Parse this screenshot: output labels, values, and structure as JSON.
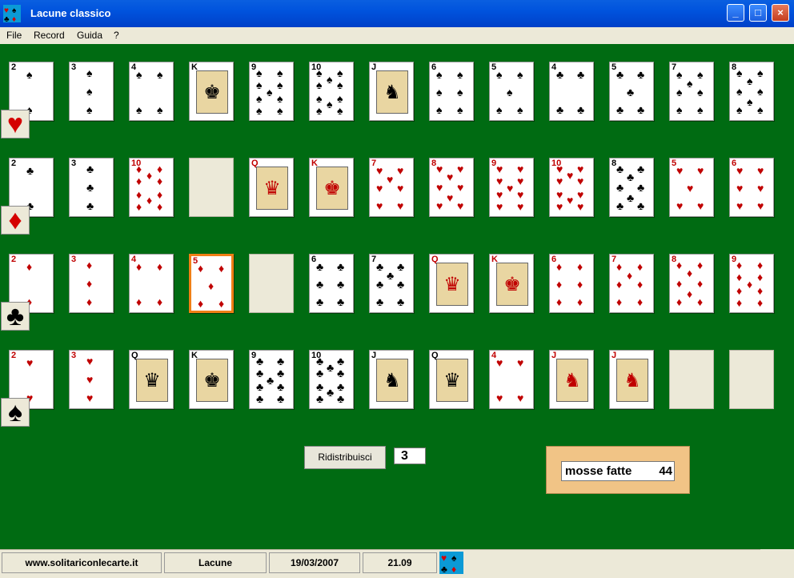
{
  "app": {
    "title": "Lacune  classico",
    "menu": [
      "File",
      "Record",
      "Guida",
      "?"
    ],
    "controls": {
      "minimize": "minimize-icon",
      "maximize": "maximize-icon",
      "close": "close-icon"
    }
  },
  "board": {
    "row_suits": [
      {
        "name": "heart",
        "symbol": "♥",
        "color": "#d40000"
      },
      {
        "name": "diamond",
        "symbol": "♦",
        "color": "#d40000"
      },
      {
        "name": "club",
        "symbol": "♣",
        "color": "#000000"
      },
      {
        "name": "spade",
        "symbol": "♠",
        "color": "#000000"
      }
    ],
    "rows": [
      [
        "2♠",
        "3♠",
        "4♠",
        "K♣",
        "9♠",
        "10♠",
        "J♠",
        "6♠",
        "5♠",
        "4♣",
        "5♣",
        "7♠",
        "8♠"
      ],
      [
        "2♣",
        "3♣",
        "10♦",
        "",
        "Q♦",
        "K♦",
        "7♥",
        "8♥",
        "9♥",
        "10♥",
        "8♣",
        "5♥",
        "6♥"
      ],
      [
        "2♦",
        "3♦",
        "4♦",
        "5♦",
        "",
        "6♣",
        "7♣",
        "Q♥",
        "K♥",
        "6♦",
        "7♦",
        "8♦",
        "9♦"
      ],
      [
        "2♥",
        "3♥",
        "Q♠",
        "K♠",
        "9♣",
        "10♣",
        "J♣",
        "Q♣",
        "4♥",
        "J♥",
        "J♦",
        "",
        ""
      ]
    ],
    "selected_card": "5♦"
  },
  "controls": {
    "redeal_button": "Ridistribuisci",
    "redeal_count": "3"
  },
  "score": {
    "label": "mosse fatte",
    "value": "44"
  },
  "statusbar": {
    "site": "www.solitariconlecarte.it",
    "game": "Lacune",
    "date": "19/03/2007",
    "time": "21.09"
  }
}
